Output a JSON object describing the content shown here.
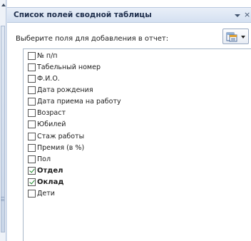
{
  "pane": {
    "title": "Список полей сводной таблицы",
    "close_label": "×",
    "instruction": "Выберите поля для добавления в отчет:"
  },
  "fields": [
    {
      "label": "№ п/п",
      "checked": false
    },
    {
      "label": "Табельный номер",
      "checked": false
    },
    {
      "label": "Ф.И.О.",
      "checked": false
    },
    {
      "label": "Дата рождения",
      "checked": false
    },
    {
      "label": "Дата приема на работу",
      "checked": false
    },
    {
      "label": "Возраст",
      "checked": false
    },
    {
      "label": "Юбилей",
      "checked": false
    },
    {
      "label": "Стаж работы",
      "checked": false
    },
    {
      "label": "Премия (в %)",
      "checked": false
    },
    {
      "label": "Пол",
      "checked": false
    },
    {
      "label": "Отдел",
      "checked": true
    },
    {
      "label": "Оклад",
      "checked": true
    },
    {
      "label": "Дети",
      "checked": false
    }
  ],
  "icons": {
    "layout": "field-list-layout-icon",
    "dropdown": "chevron-down-icon",
    "close": "close-icon"
  }
}
